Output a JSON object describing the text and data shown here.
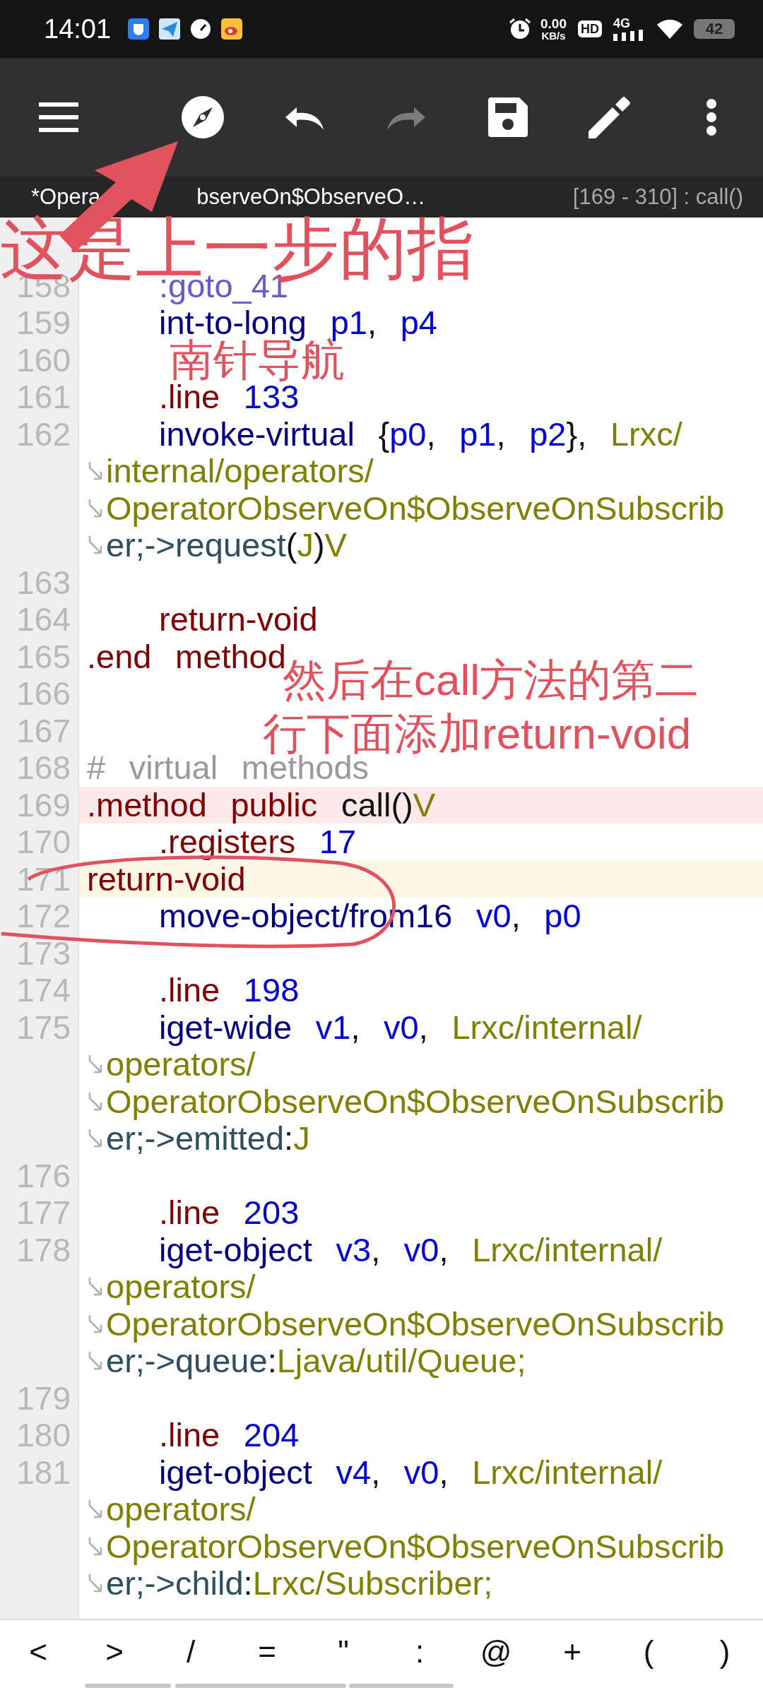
{
  "status_bar": {
    "time": "14:01",
    "apps": [
      {
        "kind": "shield"
      },
      {
        "kind": "plane"
      },
      {
        "kind": "gauge"
      },
      {
        "kind": "weibo"
      }
    ],
    "speed": "0.00",
    "speed_unit": "KB/s",
    "hd": "HD",
    "network": "4G",
    "battery": "42"
  },
  "toolbar": [
    {
      "kind": "menu",
      "disabled": false
    },
    {
      "kind": "compass",
      "disabled": false
    },
    {
      "kind": "undo",
      "disabled": false
    },
    {
      "kind": "redo",
      "disabled": true
    },
    {
      "kind": "save",
      "disabled": false
    },
    {
      "kind": "edit",
      "disabled": false
    },
    {
      "kind": "more",
      "disabled": false
    }
  ],
  "file_bar": {
    "title_parts": [
      "*Opera",
      "bserveOn$ObserveO…"
    ],
    "position": "[169 - 310] : call()"
  },
  "lines": [
    {
      "number": "158",
      "indent": true,
      "tokens": [
        {
          "kind": "label",
          "text": ":goto_41"
        }
      ]
    },
    {
      "number": "159",
      "indent": true,
      "tokens": [
        {
          "kind": "op",
          "text": "int-to-long  "
        },
        {
          "kind": "reg",
          "text": "p1"
        },
        {
          "kind": "punct",
          "text": ",  "
        },
        {
          "kind": "reg",
          "text": "p4"
        }
      ]
    },
    {
      "number": "160"
    },
    {
      "number": "161",
      "indent": true,
      "tokens": [
        {
          "kind": "directive",
          "text": ".line  "
        },
        {
          "kind": "num",
          "text": "133"
        }
      ]
    },
    {
      "number": "162",
      "indent": true,
      "tokens": [
        {
          "kind": "op",
          "text": "invoke-virtual"
        },
        {
          "kind": "punct",
          "text": "  {"
        },
        {
          "kind": "reg",
          "text": "p0"
        },
        {
          "kind": "punct",
          "text": ",  "
        },
        {
          "kind": "reg",
          "text": "p1"
        },
        {
          "kind": "punct",
          "text": ",  "
        },
        {
          "kind": "reg",
          "text": "p2"
        },
        {
          "kind": "punct",
          "text": "},  "
        },
        {
          "kind": "type",
          "text": "Lrxc/"
        }
      ]
    },
    {
      "wrap": true,
      "tokens": [
        {
          "kind": "type",
          "text": "internal/operators/"
        }
      ]
    },
    {
      "wrap": true,
      "tokens": [
        {
          "kind": "type",
          "text": "OperatorObserveOn$ObserveOnSubscrib"
        }
      ]
    },
    {
      "wrap": true,
      "tokens": [
        {
          "kind": "member",
          "text": "er;->request"
        },
        {
          "kind": "punct",
          "text": "("
        },
        {
          "kind": "type",
          "text": "J"
        },
        {
          "kind": "punct",
          "text": ")"
        },
        {
          "kind": "type",
          "text": "V"
        }
      ]
    },
    {
      "number": "163"
    },
    {
      "number": "164",
      "indent": true,
      "tokens": [
        {
          "kind": "directive",
          "text": "return-void"
        }
      ]
    },
    {
      "number": "165",
      "tokens": [
        {
          "kind": "directive",
          "text": ".end  method"
        }
      ]
    },
    {
      "number": "166"
    },
    {
      "number": "167"
    },
    {
      "number": "168",
      "tokens": [
        {
          "kind": "comment",
          "text": "#  virtual  methods"
        }
      ]
    },
    {
      "number": "169",
      "highlighted": true,
      "tokens": [
        {
          "kind": "directive",
          "text": ".method  public"
        },
        {
          "kind": "punct",
          "text": "  call()"
        },
        {
          "kind": "type",
          "text": "V"
        }
      ]
    },
    {
      "number": "170",
      "indent": true,
      "tokens": [
        {
          "kind": "directive",
          "text": ".registers  "
        },
        {
          "kind": "num",
          "text": "17"
        }
      ]
    },
    {
      "number": "171",
      "current": true,
      "tokens": [
        {
          "kind": "directive",
          "text": "return-void"
        }
      ]
    },
    {
      "number": "172",
      "indent": true,
      "tokens": [
        {
          "kind": "op",
          "text": "move-object/from16  "
        },
        {
          "kind": "reg",
          "text": "v0"
        },
        {
          "kind": "punct",
          "text": ",  "
        },
        {
          "kind": "reg",
          "text": "p0"
        }
      ]
    },
    {
      "number": "173"
    },
    {
      "number": "174",
      "indent": true,
      "tokens": [
        {
          "kind": "directive",
          "text": ".line  "
        },
        {
          "kind": "num",
          "text": "198"
        }
      ]
    },
    {
      "number": "175",
      "indent": true,
      "tokens": [
        {
          "kind": "op",
          "text": "iget-wide  "
        },
        {
          "kind": "reg",
          "text": "v1"
        },
        {
          "kind": "punct",
          "text": ",  "
        },
        {
          "kind": "reg",
          "text": "v0"
        },
        {
          "kind": "punct",
          "text": ",  "
        },
        {
          "kind": "type",
          "text": "Lrxc/internal/"
        }
      ]
    },
    {
      "wrap": true,
      "tokens": [
        {
          "kind": "type",
          "text": "operators/"
        }
      ]
    },
    {
      "wrap": true,
      "tokens": [
        {
          "kind": "type",
          "text": "OperatorObserveOn$ObserveOnSubscrib"
        }
      ]
    },
    {
      "wrap": true,
      "tokens": [
        {
          "kind": "member",
          "text": "er;->emitted"
        },
        {
          "kind": "punct",
          "text": ":"
        },
        {
          "kind": "type",
          "text": "J"
        }
      ]
    },
    {
      "number": "176"
    },
    {
      "number": "177",
      "indent": true,
      "tokens": [
        {
          "kind": "directive",
          "text": ".line  "
        },
        {
          "kind": "num",
          "text": "203"
        }
      ]
    },
    {
      "number": "178",
      "indent": true,
      "tokens": [
        {
          "kind": "op",
          "text": "iget-object  "
        },
        {
          "kind": "reg",
          "text": "v3"
        },
        {
          "kind": "punct",
          "text": ",  "
        },
        {
          "kind": "reg",
          "text": "v0"
        },
        {
          "kind": "punct",
          "text": ",  "
        },
        {
          "kind": "type",
          "text": "Lrxc/internal/"
        }
      ]
    },
    {
      "wrap": true,
      "tokens": [
        {
          "kind": "type",
          "text": "operators/"
        }
      ]
    },
    {
      "wrap": true,
      "tokens": [
        {
          "kind": "type",
          "text": "OperatorObserveOn$ObserveOnSubscrib"
        }
      ]
    },
    {
      "wrap": true,
      "tokens": [
        {
          "kind": "member",
          "text": "er;->queue"
        },
        {
          "kind": "punct",
          "text": ":"
        },
        {
          "kind": "type",
          "text": "Ljava/util/Queue;"
        }
      ]
    },
    {
      "number": "179"
    },
    {
      "number": "180",
      "indent": true,
      "tokens": [
        {
          "kind": "directive",
          "text": ".line  "
        },
        {
          "kind": "num",
          "text": "204"
        }
      ]
    },
    {
      "number": "181",
      "indent": true,
      "tokens": [
        {
          "kind": "op",
          "text": "iget-object  "
        },
        {
          "kind": "reg",
          "text": "v4"
        },
        {
          "kind": "punct",
          "text": ",  "
        },
        {
          "kind": "reg",
          "text": "v0"
        },
        {
          "kind": "punct",
          "text": ",  "
        },
        {
          "kind": "type",
          "text": "Lrxc/internal/"
        }
      ]
    },
    {
      "wrap": true,
      "tokens": [
        {
          "kind": "type",
          "text": "operators/"
        }
      ]
    },
    {
      "wrap": true,
      "tokens": [
        {
          "kind": "type",
          "text": "OperatorObserveOn$ObserveOnSubscrib"
        }
      ]
    },
    {
      "wrap": true,
      "tokens": [
        {
          "kind": "member",
          "text": "er;->child"
        },
        {
          "kind": "punct",
          "text": ":"
        },
        {
          "kind": "type",
          "text": "Lrxc/Subscriber;"
        }
      ]
    }
  ],
  "symbol_keys": [
    "<",
    ">",
    "/",
    "=",
    "\"",
    ":",
    "@",
    "+",
    "(",
    ")"
  ],
  "annotations": [
    {
      "lines": [
        "这是上一步的指",
        "南针导航"
      ]
    },
    {
      "lines": [
        "然后在call方法的第二",
        "行下面添加return-void"
      ]
    }
  ]
}
